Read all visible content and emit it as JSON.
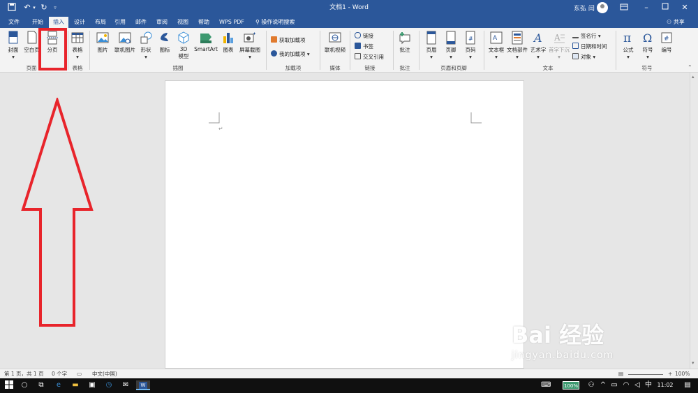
{
  "title": "文档1 - Word",
  "user": "东弘 闫",
  "share_label": "共享",
  "tell_me": "操作说明搜索",
  "tabs": [
    {
      "label": "文件"
    },
    {
      "label": "开始"
    },
    {
      "label": "插入"
    },
    {
      "label": "设计"
    },
    {
      "label": "布局"
    },
    {
      "label": "引用"
    },
    {
      "label": "邮件"
    },
    {
      "label": "审阅"
    },
    {
      "label": "视图"
    },
    {
      "label": "帮助"
    },
    {
      "label": "WPS PDF"
    }
  ],
  "ribbon": {
    "pages": {
      "cover": "封面",
      "blank": "空白页",
      "break": "分页",
      "group": "页面"
    },
    "table": {
      "table": "表格",
      "group": "表格"
    },
    "illustrations": {
      "pictures": "图片",
      "online_pictures": "联机图片",
      "shapes": "形状",
      "icons": "图标",
      "model3d_1": "3D",
      "model3d_2": "模型",
      "smartart": "SmartArt",
      "chart": "图表",
      "screenshot": "屏幕截图",
      "group": "插图"
    },
    "addins": {
      "get": "获取加载项",
      "mine": "我的加载项",
      "group": "加载项"
    },
    "media": {
      "video": "联机视频",
      "group": "媒体"
    },
    "links": {
      "link": "链接",
      "bookmark": "书签",
      "cross": "交叉引用",
      "group": "链接"
    },
    "comments": {
      "comment": "批注",
      "group": "批注"
    },
    "header_footer": {
      "header": "页眉",
      "footer": "页脚",
      "page_number": "页码",
      "group": "页眉和页脚"
    },
    "text": {
      "textbox": "文本框",
      "quickparts": "文档部件",
      "wordart": "艺术字",
      "dropcap": "首字下沉",
      "signature": "签名行",
      "datetime": "日期和时间",
      "object": "对象",
      "group": "文本"
    },
    "symbols": {
      "equation": "公式",
      "symbol": "符号",
      "number": "编号",
      "group": "符号"
    }
  },
  "status": {
    "pages": "第 1 页，共 1 页",
    "words": "0 个字",
    "lang": "中文(中国)",
    "zoom": "100%"
  },
  "taskbar": {
    "battery": "100%",
    "ime": "中",
    "time": "11:02"
  },
  "watermark": {
    "logo": "Bai 经验",
    "url": "jingyan.baidu.com"
  }
}
